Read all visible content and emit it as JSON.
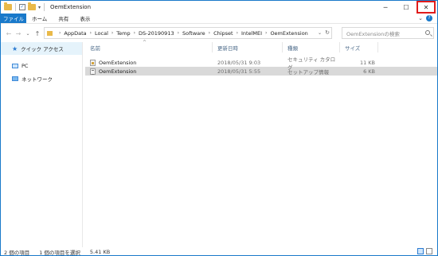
{
  "window": {
    "title": "OemExtension",
    "controls": {
      "minimize": "─",
      "maximize": "☐",
      "close": "✕"
    }
  },
  "ribbon": {
    "tabs": [
      "ファイル",
      "ホーム",
      "共有",
      "表示"
    ],
    "help": "?"
  },
  "address": {
    "breadcrumbs": [
      "AppData",
      "Local",
      "Temp",
      "DS-20190913",
      "Software",
      "Chipset",
      "IntelMEI",
      "OemExtension"
    ],
    "search_placeholder": "OemExtensionの検索"
  },
  "nav_pane": {
    "items": [
      {
        "label": "クイック アクセス",
        "icon": "star-icon",
        "selected": true
      },
      {
        "label": "PC",
        "icon": "pc-icon",
        "selected": false
      },
      {
        "label": "ネットワーク",
        "icon": "network-icon",
        "selected": false
      }
    ]
  },
  "file_list": {
    "columns": {
      "name": "名前",
      "date": "更新日時",
      "type": "種類",
      "size": "サイズ"
    },
    "rows": [
      {
        "name": "OemExtension",
        "date": "2018/05/31 9:03",
        "type": "セキュリティ カタログ",
        "size": "11 KB",
        "icon": "catalog-file-icon",
        "selected": false
      },
      {
        "name": "OemExtension",
        "date": "2018/05/31 5:55",
        "type": "セットアップ情報",
        "size": "6 KB",
        "icon": "setup-info-file-icon",
        "selected": true
      }
    ]
  },
  "status": {
    "count": "2 個の項目",
    "selection": "1 個の項目を選択",
    "size": "5.41 KB"
  },
  "colors": {
    "accent": "#1979ca",
    "close_highlight": "#e01b1b",
    "selected_row": "#d9d9d9"
  }
}
